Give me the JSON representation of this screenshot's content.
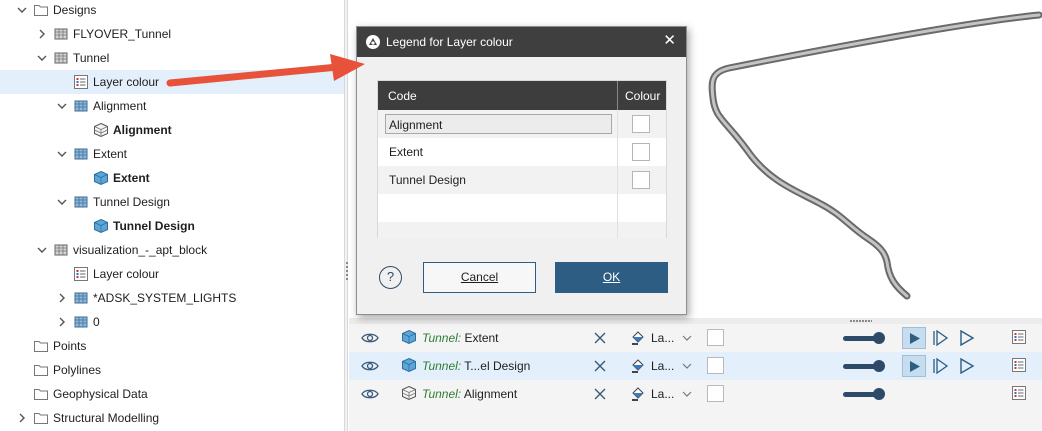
{
  "tree": {
    "items": [
      {
        "label": "Designs"
      },
      {
        "label": "FLYOVER_Tunnel"
      },
      {
        "label": "Tunnel"
      },
      {
        "label": "Layer colour"
      },
      {
        "label": "Alignment"
      },
      {
        "label": "Alignment"
      },
      {
        "label": "Extent"
      },
      {
        "label": "Extent"
      },
      {
        "label": "Tunnel Design"
      },
      {
        "label": "Tunnel Design"
      },
      {
        "label": "visualization_-_apt_block"
      },
      {
        "label": "Layer colour"
      },
      {
        "label": "*ADSK_SYSTEM_LIGHTS"
      },
      {
        "label": "0"
      },
      {
        "label": "Points"
      },
      {
        "label": "Polylines"
      },
      {
        "label": "Geophysical Data"
      },
      {
        "label": "Structural Modelling"
      }
    ]
  },
  "dialog": {
    "title": "Legend for Layer colour",
    "columns": {
      "code": "Code",
      "colour": "Colour"
    },
    "rows": [
      {
        "code": "Alignment"
      },
      {
        "code": "Extent"
      },
      {
        "code": "Tunnel Design"
      }
    ],
    "cancel_label": "Cancel",
    "ok_label": "OK",
    "help_glyph": "?",
    "close_glyph": "✕"
  },
  "objects": [
    {
      "prefix": "Tunnel:",
      "name": "Extent",
      "colour_label": "La..."
    },
    {
      "prefix": "Tunnel:",
      "name": "T...el Design",
      "colour_label": "La..."
    },
    {
      "prefix": "Tunnel:",
      "name": "Alignment",
      "colour_label": "La..."
    }
  ],
  "colors": {
    "selection": "#e3f0fb",
    "header": "#3d3d3d",
    "ok_button": "#2d5d83",
    "arrow": "#e8513a",
    "italic_prefix": "#2e7d32"
  }
}
